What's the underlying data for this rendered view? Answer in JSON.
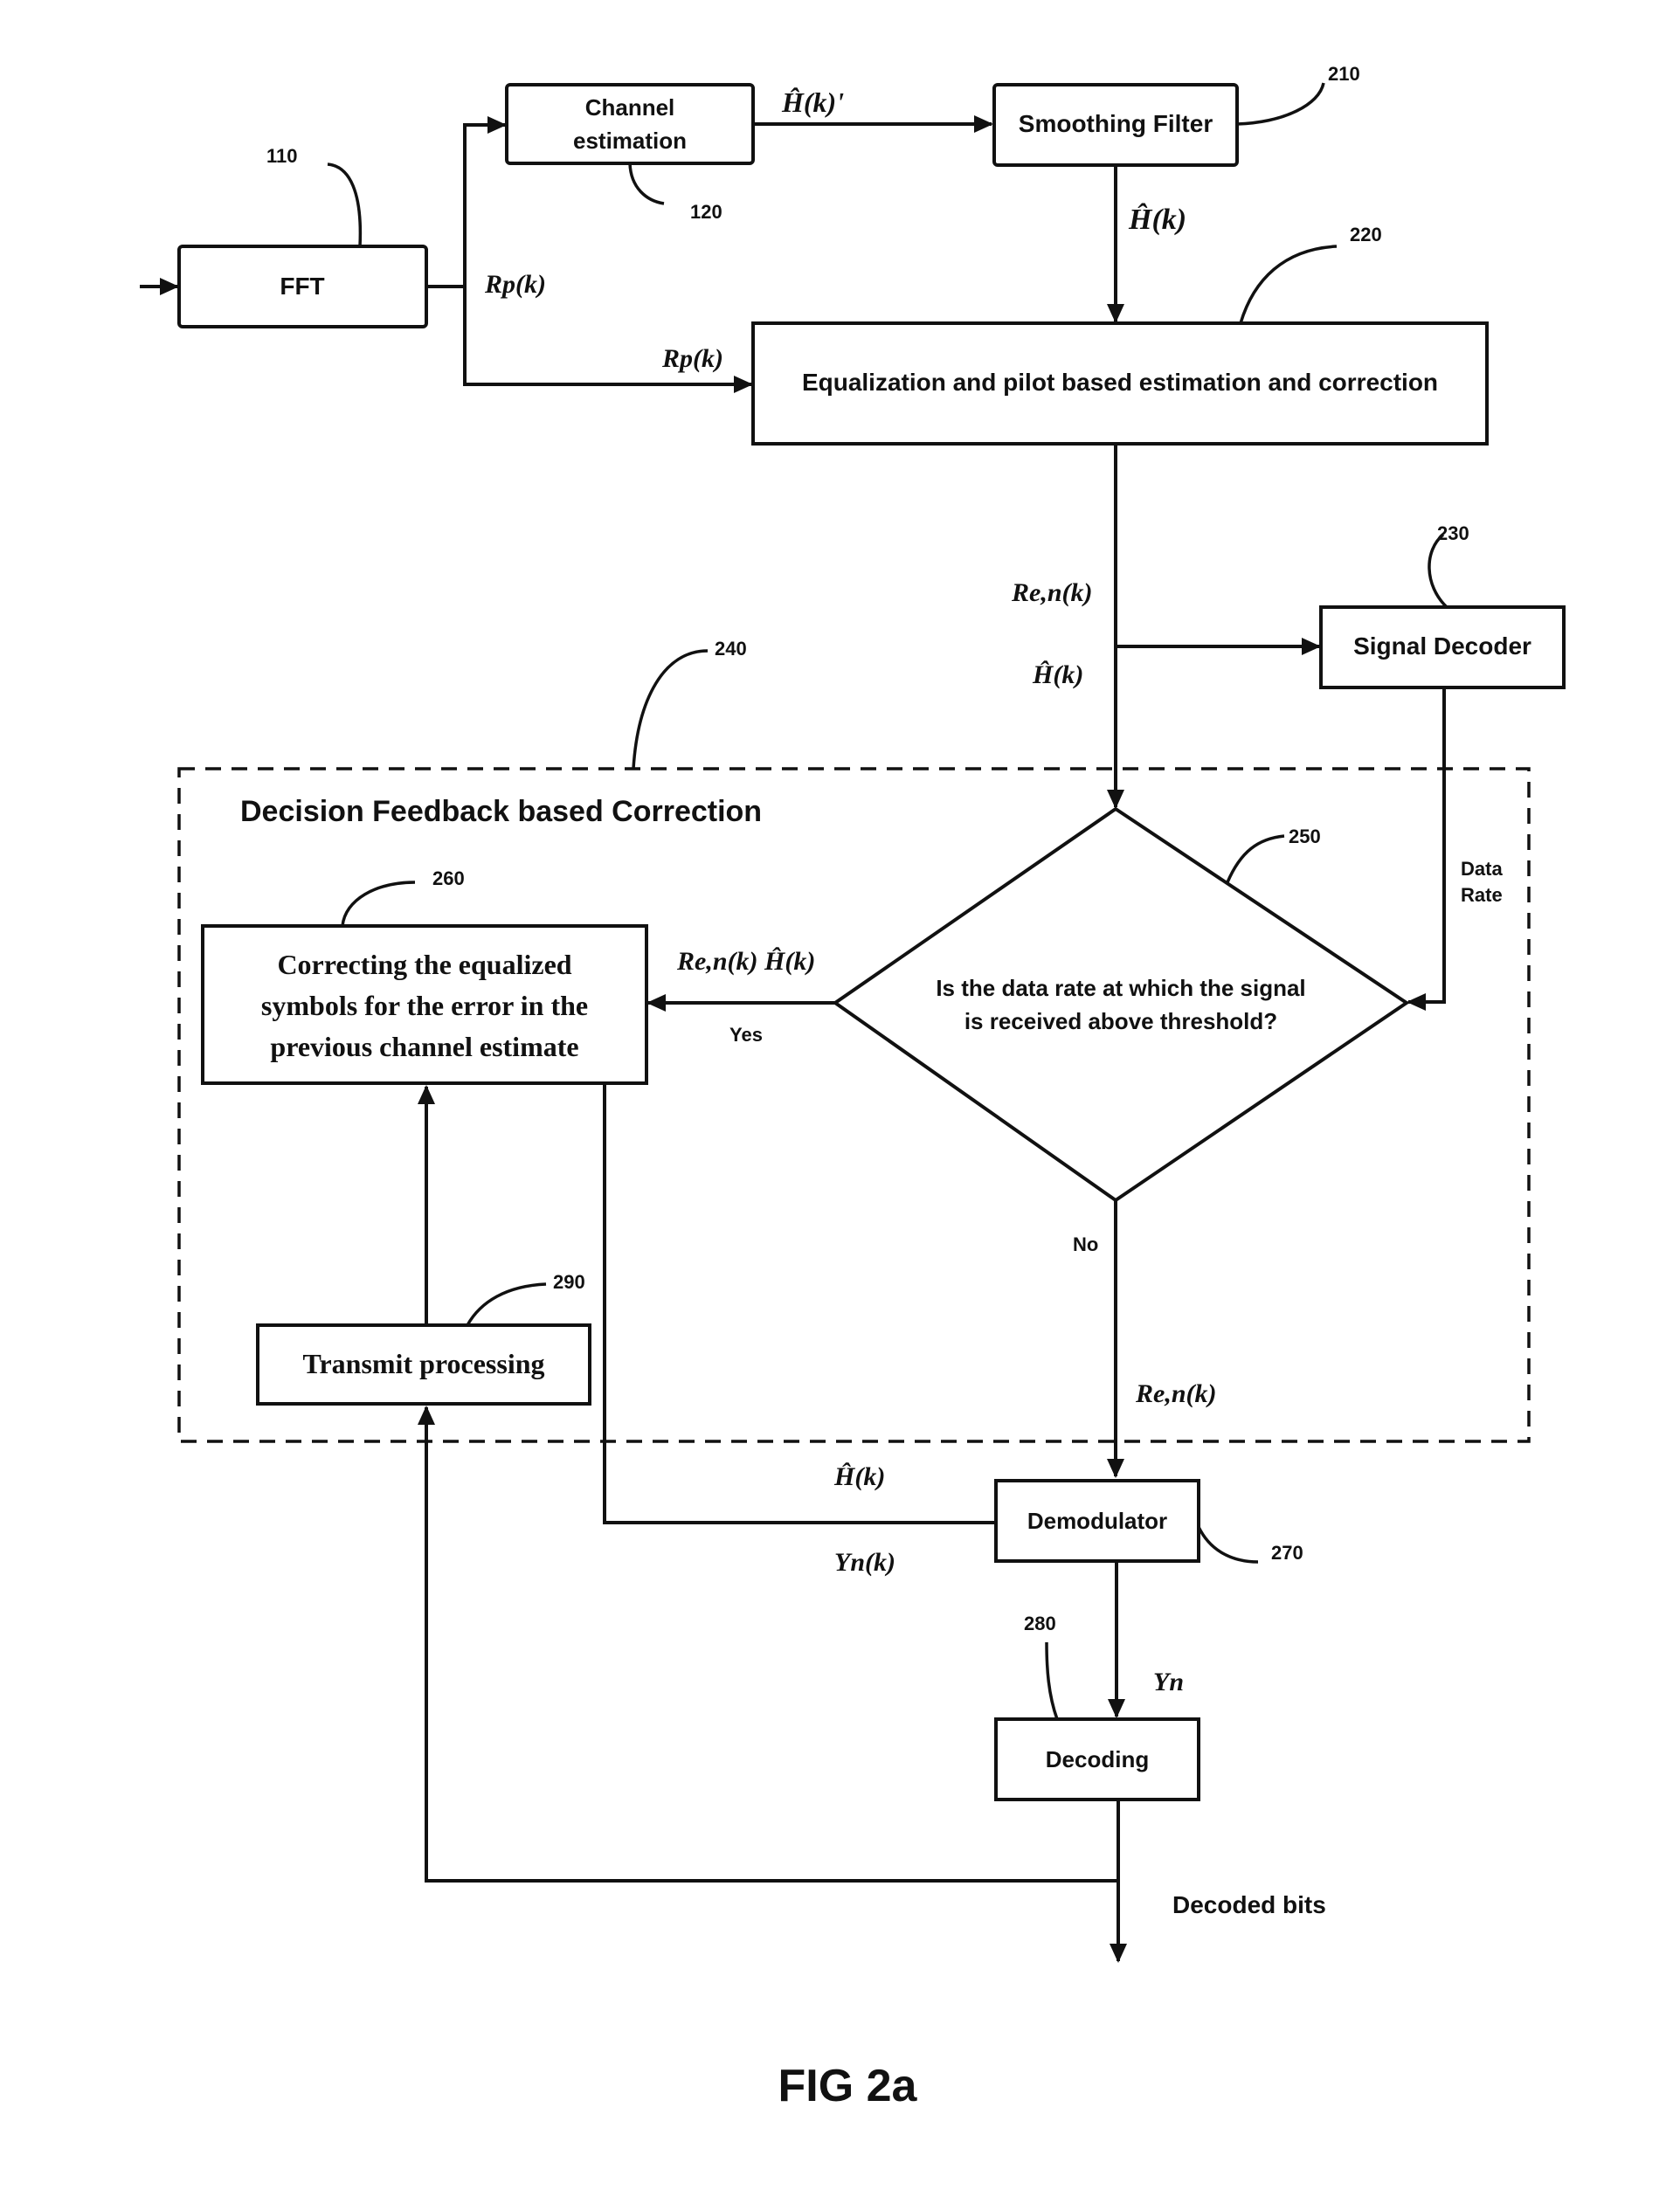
{
  "figure": {
    "caption": "FIG 2a",
    "group": {
      "title": "Decision Feedback based Correction",
      "ref": "240"
    },
    "blocks": {
      "fft": {
        "label": "FFT",
        "ref": "110"
      },
      "channel_estimation": {
        "label_line1": "Channel",
        "label_line2": "estimation",
        "ref": "120"
      },
      "smoothing_filter": {
        "label": "Smoothing Filter",
        "ref": "210"
      },
      "equalization": {
        "label": "Equalization and pilot based estimation and correction",
        "ref": "220"
      },
      "signal_decoder": {
        "label": "Signal Decoder",
        "ref": "230"
      },
      "decision": {
        "label_line1": "Is the data rate at which the signal",
        "label_line2": "is received above threshold?",
        "ref": "250"
      },
      "correcting": {
        "label_line1": "Correcting the equalized",
        "label_line2": "symbols for the error in the",
        "label_line3": "previous channel estimate",
        "ref": "260"
      },
      "demodulator": {
        "label": "Demodulator",
        "ref": "270"
      },
      "decoding": {
        "label": "Decoding",
        "ref": "280"
      },
      "transmit_processing": {
        "label": "Transmit processing",
        "ref": "290"
      }
    },
    "signals": {
      "h_hat_prime": "Ĥ(k)'",
      "h_hat_smooth": "Ĥ(k)",
      "rp_upper": "Rp(k)",
      "rp_lower": "Rp(k)",
      "ren_main": "Re,n(k)",
      "h_hat_main": "Ĥ(k)",
      "data_rate_line1": "Data",
      "data_rate_line2": "Rate",
      "yes_signals": "Re,n(k)  Ĥ(k)",
      "yes": "Yes",
      "no": "No",
      "ren_no": "Re,n(k)",
      "h_hat_demod": "Ĥ(k)",
      "yn_k": "Yn(k)",
      "yn": "Yn",
      "decoded_bits": "Decoded bits"
    }
  }
}
